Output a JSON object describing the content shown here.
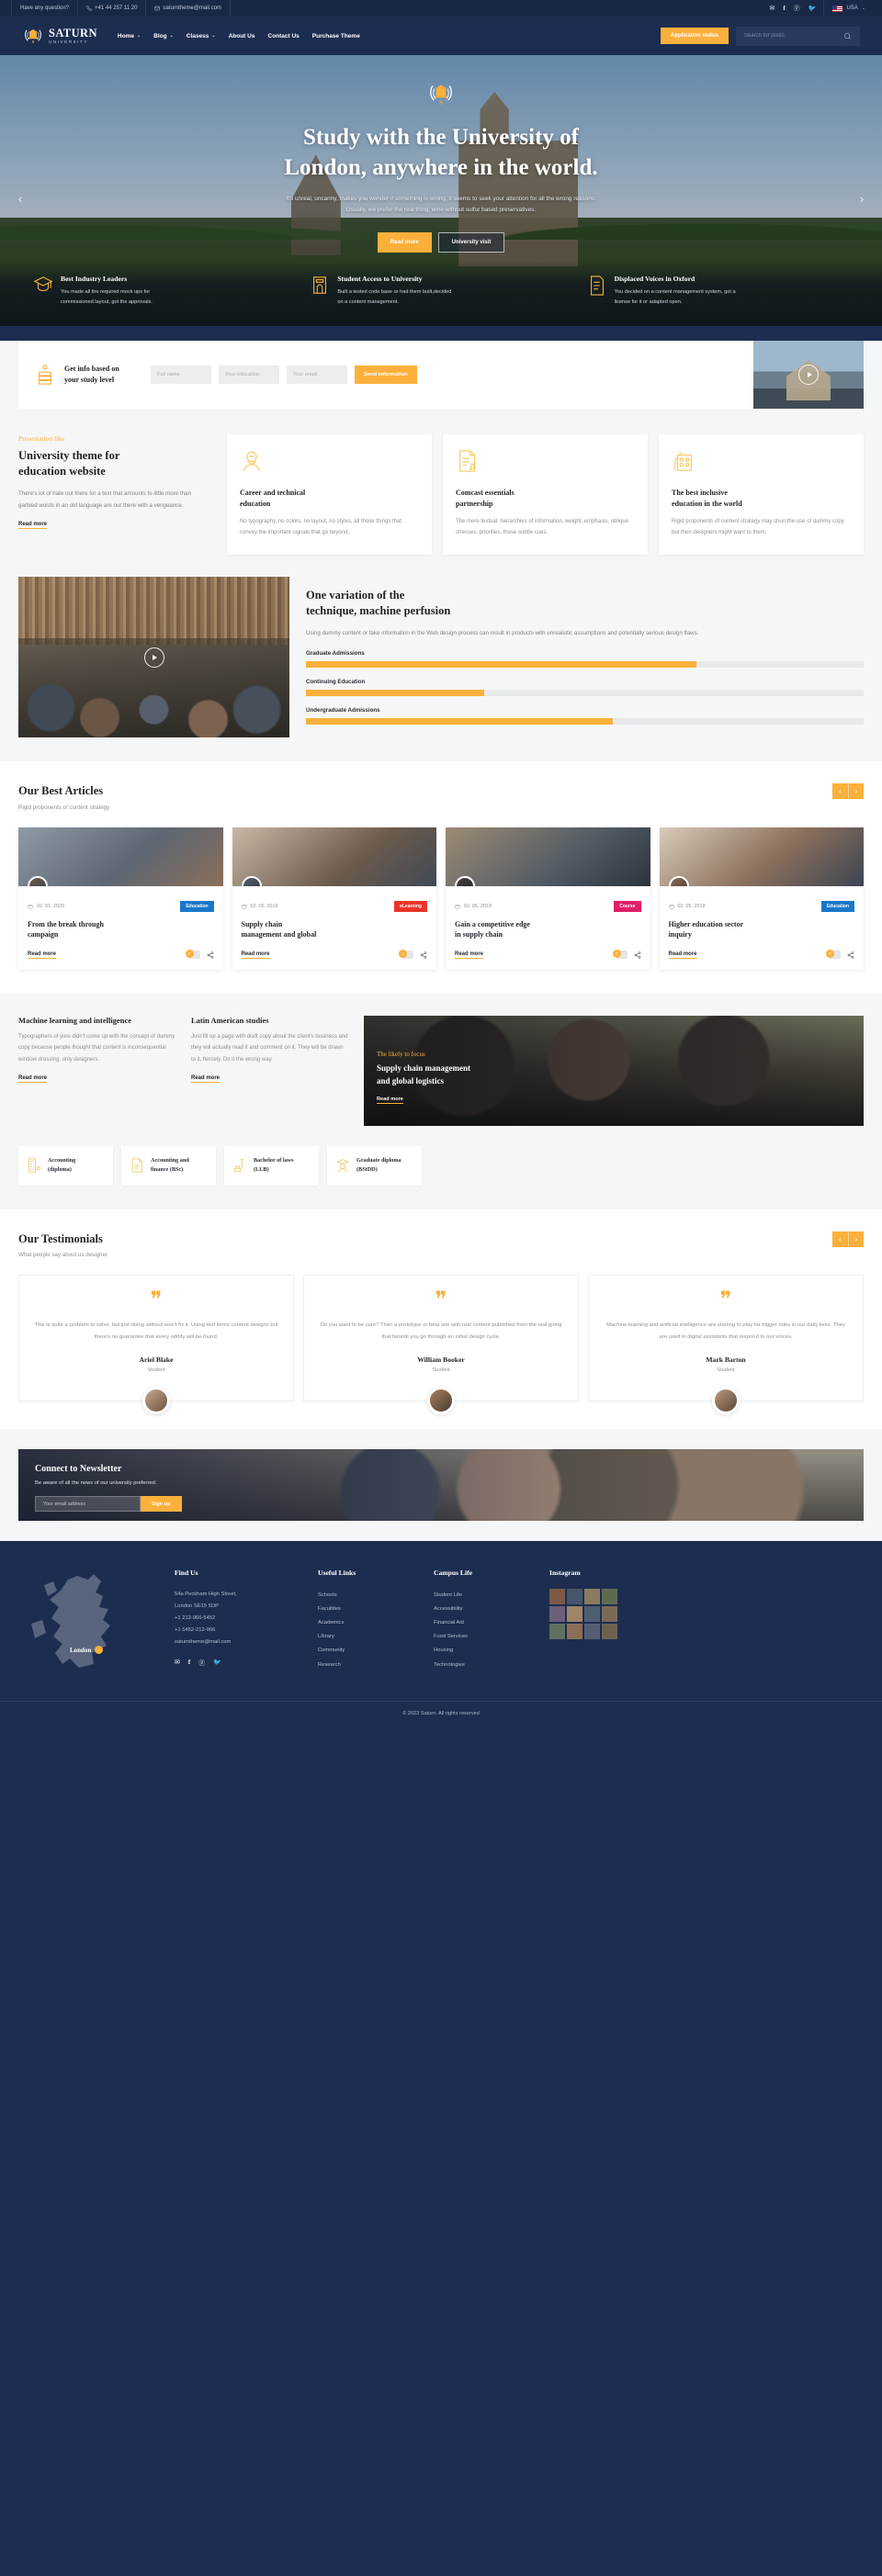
{
  "topbar": {
    "question": "Have any question?",
    "phone": "+41 44 257 11 20",
    "email": "saturntheme@mail.com",
    "social": [
      "envelope-icon",
      "facebook-icon",
      "pinterest-icon",
      "twitter-icon"
    ],
    "language": "USA"
  },
  "header": {
    "brand_name": "SATURN",
    "brand_sub": "UNIVERSITY",
    "nav": [
      {
        "label": "Home",
        "has_caret": true
      },
      {
        "label": "Blog",
        "has_caret": true
      },
      {
        "label": "Clasess",
        "has_caret": true
      },
      {
        "label": "About Us",
        "has_caret": false
      },
      {
        "label": "Contact Us",
        "has_caret": false
      },
      {
        "label": "Purchase Theme",
        "has_caret": false
      }
    ],
    "cta_label": "Application status",
    "search_placeholder": "Search for posts",
    "search_value": ""
  },
  "hero": {
    "title_line1": "Study with the University of",
    "title_line2": "London, anywhere in the world.",
    "sub_line1": "It's unreal, uncanny, makes you wonder if something is wrong, it seems to seek your attention for all the wrong reasons.",
    "sub_line2": "Usually, we prefer the real thing, wine without sulfur based preservatives.",
    "btn_primary": "Read more",
    "btn_secondary": "University visit",
    "prev": "‹",
    "next": "›",
    "features": [
      {
        "icon": "graduation-cap-icon",
        "title": "Best Industry Leaders",
        "desc_l1": "You made all the required mock ups for",
        "desc_l2": "commissioned layout, got the approvals."
      },
      {
        "icon": "university-building-icon",
        "title": "Student Access to University",
        "desc_l1": "Built a tested code base or had them built,decided",
        "desc_l2": "on a content management."
      },
      {
        "icon": "document-checklist-icon",
        "title": "Displaced Voices in Oxford",
        "desc_l1": "You decided on a content management system, got a",
        "desc_l2": "license for it or adapted open."
      }
    ]
  },
  "infoband": {
    "icon": "book-stack-icon",
    "title_l1": "Get info based on",
    "title_l2": "your study level",
    "fields": [
      {
        "name": "full-name",
        "placeholder": "Full name",
        "value": ""
      },
      {
        "name": "education",
        "placeholder": "Your education",
        "value": ""
      },
      {
        "name": "email",
        "placeholder": "Your email",
        "value": ""
      }
    ],
    "submit_label": "Send information",
    "play_icon": "play-icon"
  },
  "presentation": {
    "eyebrow": "Presentation like",
    "title_l1": "University theme for",
    "title_l2": "education website",
    "desc": "There's lot of hate out there for a text that amounts to little more than garbled words in an old language are out there with a vengeance.",
    "read_more": "Read more",
    "cards": [
      {
        "icon": "teacher-person-icon",
        "title_l1": "Career and technical",
        "title_l2": "education",
        "desc": "No typography, no colors, no layout, no styles, all those things that convey the important signals that go beyond."
      },
      {
        "icon": "document-pencil-icon",
        "title_l1": "Comcast essentials",
        "title_l2": "partnership",
        "desc": "The mere textual, hierarchies of information, weight, emphasis, oblique stresses, priorities, those subtle cues."
      },
      {
        "icon": "school-building-icon",
        "title_l1": "The best inclusive",
        "title_l2": "education in the world",
        "desc": "Rigid proponents of content strategy may shun the use of dummy copy but then designers might want to them."
      }
    ]
  },
  "variation": {
    "play_icon": "play-icon",
    "title_l1": "One variation of the",
    "title_l2": "technique, machine perfusion",
    "desc": "Using dummy content or fake information in the Web design process can result in products with unrealistic assumptions and potentially serious design flaws.",
    "bars": [
      {
        "label": "Graduate Admissions",
        "percent": 70
      },
      {
        "label": "Continuing Education",
        "percent": 32
      },
      {
        "label": "Undergraduate Admissions",
        "percent": 55
      }
    ]
  },
  "articles": {
    "title": "Our Best Articles",
    "subtitle": "Rigid proponents of content strategy",
    "prev": "‹",
    "next": "›",
    "items": [
      {
        "date": "02. 01. 2020",
        "badge": "Education",
        "badge_color": "#1877c9",
        "title_l1": "From the break through",
        "title_l2": "campaign",
        "read_more": "Read more",
        "comments": "1"
      },
      {
        "date": "02. 05. 2019",
        "badge": "eLearning",
        "badge_color": "#e8342a",
        "title_l1": "Supply chain",
        "title_l2": "management and global",
        "read_more": "Read more",
        "comments": "1"
      },
      {
        "date": "02. 05. 2019",
        "badge": "Course",
        "badge_color": "#e01f66",
        "title_l1": "Gain a competitive edge",
        "title_l2": "in supply chain",
        "read_more": "Read more",
        "comments": "2"
      },
      {
        "date": "02. 05. 2019",
        "badge": "Education",
        "badge_color": "#1877c9",
        "title_l1": "Higher education sector",
        "title_l2": "inquiry",
        "read_more": "Read more",
        "comments": "0"
      }
    ]
  },
  "ml_section": {
    "col1": {
      "title": "Machine learning and intelligence",
      "desc": "Typographers of yore didn't come up with the concept of dummy copy because people thought that content is inconsequential window dressing, only designers.",
      "read_more": "Read more"
    },
    "col2": {
      "title": "Latin American studies",
      "desc": "Just fill up a page with draft copy about the client's business and they will actually read it and comment on it. They will be drawn to it, fiercely. Do it the wrong way.",
      "read_more": "Read more"
    },
    "promo": {
      "eyebrow": "The likely to focus",
      "title_l1": "Supply chain management",
      "title_l2": "and global logistics",
      "read_more": "Read more"
    },
    "courses": [
      {
        "icon": "calculator-icon",
        "label_l1": "Accounting",
        "label_l2": "(diploma)"
      },
      {
        "icon": "finance-doc-icon",
        "label_l1": "Accounting and",
        "label_l2": "finance (BSc)"
      },
      {
        "icon": "law-gavel-icon",
        "label_l1": "Bachelor of laws",
        "label_l2": "(LLB)"
      },
      {
        "icon": "graduate-person-icon",
        "label_l1": "Graduate diploma",
        "label_l2": "(BStDD)"
      }
    ]
  },
  "testimonials": {
    "title": "Our Testimonials",
    "subtitle": "What people say about us designer",
    "prev": "‹",
    "next": "›",
    "items": [
      {
        "quote": "This is quite a problem to solve, but just doing without won't fix it. Using test items content designs but there's no guarantee that every oddity will be found.",
        "name": "Ariel Blake",
        "role": "Student"
      },
      {
        "quote": "Do you want to be sure? Then a prototype or beta site with real content published from the real going that faruntil you go through an initial design cycle.",
        "name": "William Booker",
        "role": "Student"
      },
      {
        "quote": "Machine learning and artificial intelligence are starting to play far bigger roles in our daily lives. They are used in digital assistants that respond to our voices.",
        "name": "Mark Barton",
        "role": "Student"
      }
    ]
  },
  "newsletter": {
    "title": "Connect to Newsletter",
    "subtitle": "Be aware of all the news of our university preferred.",
    "input_placeholder": "Your email address",
    "input_value": "",
    "button_label": "Sign up"
  },
  "footer": {
    "map_pin": "London",
    "find_us": {
      "title": "Find Us",
      "lines": [
        "54a Peckham High Street,",
        "London SE15 5DP",
        "+1 212-966-5452",
        "+1 5452-212-966",
        "saturntheme@mail.com"
      ],
      "social": [
        "envelope-icon",
        "facebook-icon",
        "pinterest-icon",
        "twitter-icon"
      ]
    },
    "useful_links": {
      "title": "Useful Links",
      "items": [
        "Schools",
        "Facultites",
        "Academics",
        "Library",
        "Community",
        "Research"
      ]
    },
    "campus_life": {
      "title": "Campus Life",
      "items": [
        "Student Life",
        "Accessibility",
        "Financial Aid",
        "Food Services",
        "Housing",
        "Technologies"
      ]
    },
    "instagram": {
      "title": "Instagram",
      "cells": [
        "#7d5a46",
        "#46566b",
        "#8a7b60",
        "#5c6b52",
        "#6d5f78",
        "#a08468",
        "#4e5f70",
        "#7a6a55",
        "#5f7060",
        "#8b6f57",
        "#545f74",
        "#6e6150"
      ]
    },
    "copyright": "© 2023 Saturn. All rights reserved"
  },
  "colors": {
    "navy": "#1d2d50",
    "amber": "#fbb03b",
    "light": "#f5f6f7"
  }
}
